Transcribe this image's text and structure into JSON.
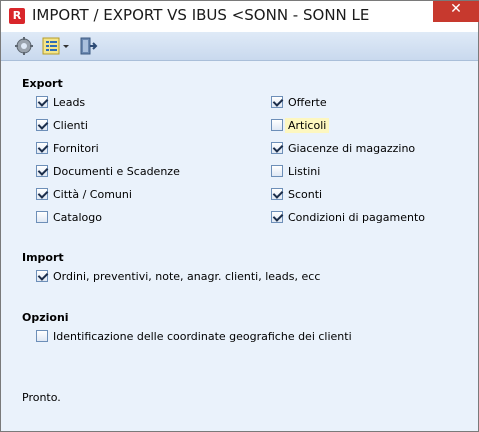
{
  "window": {
    "title": "IMPORT / EXPORT VS IBUS <SONN - SONN LEON...",
    "close_label": "✕"
  },
  "toolbar": {
    "icons": [
      "gear-icon",
      "list-dropdown-icon",
      "exit-door-icon"
    ]
  },
  "export": {
    "heading": "Export",
    "left": [
      {
        "label": "Leads",
        "checked": true
      },
      {
        "label": "Clienti",
        "checked": true
      },
      {
        "label": "Fornitori",
        "checked": true
      },
      {
        "label": "Documenti e Scadenze",
        "checked": true
      },
      {
        "label": "Città / Comuni",
        "checked": true
      },
      {
        "label": "Catalogo",
        "checked": false
      }
    ],
    "right": [
      {
        "label": "Offerte",
        "checked": true
      },
      {
        "label": "Articoli",
        "checked": false
      },
      {
        "label": "Giacenze di magazzino",
        "checked": true
      },
      {
        "label": "Listini",
        "checked": false
      },
      {
        "label": "Sconti",
        "checked": true
      },
      {
        "label": "Condizioni di pagamento",
        "checked": true
      }
    ]
  },
  "import": {
    "heading": "Import",
    "items": [
      {
        "label": "Ordini,  preventivi, note, anagr. clienti, leads, ecc",
        "checked": true
      }
    ]
  },
  "options": {
    "heading": "Opzioni",
    "items": [
      {
        "label": "Identificazione delle coordinate geografiche dei clienti",
        "checked": false
      }
    ]
  },
  "status": "Pronto."
}
